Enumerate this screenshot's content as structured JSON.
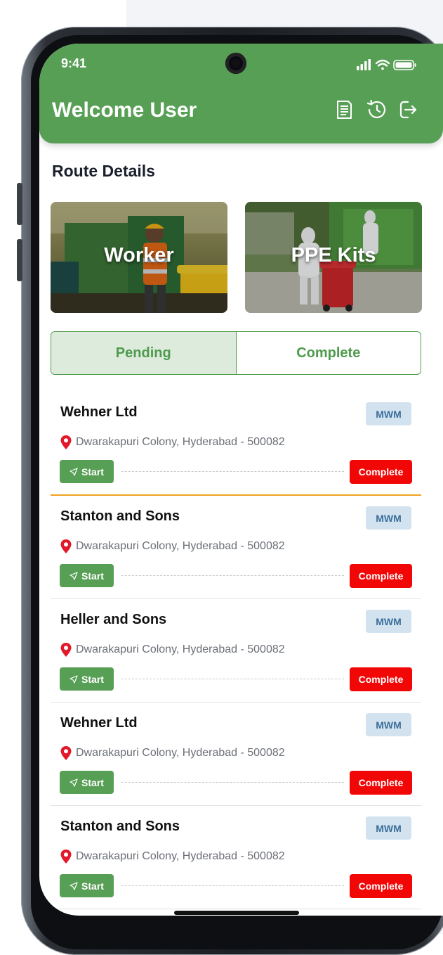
{
  "status_bar": {
    "time": "9:41"
  },
  "header": {
    "title": "Welcome User",
    "icons": [
      "notes-icon",
      "history-icon",
      "logout-icon"
    ]
  },
  "route": {
    "section_title": "Route Details",
    "cards": [
      {
        "label": "Worker",
        "image": "worker-photo"
      },
      {
        "label": "PPE Kits",
        "image": "ppe-kits-photo"
      }
    ]
  },
  "tabs": [
    {
      "label": "Pending",
      "active": true
    },
    {
      "label": "Complete",
      "active": false
    }
  ],
  "items": [
    {
      "name": "Wehner Ltd",
      "badge": "MWM",
      "address": "Dwarakapuri Colony, Hyderabad - 500082",
      "start_label": "Start",
      "complete_label": "Complete"
    },
    {
      "name": "Stanton and Sons",
      "badge": "MWM",
      "address": "Dwarakapuri Colony, Hyderabad - 500082",
      "start_label": "Start",
      "complete_label": "Complete"
    },
    {
      "name": "Heller and Sons",
      "badge": "MWM",
      "address": "Dwarakapuri Colony, Hyderabad - 500082",
      "start_label": "Start",
      "complete_label": "Complete"
    },
    {
      "name": "Wehner Ltd",
      "badge": "MWM",
      "address": "Dwarakapuri Colony, Hyderabad - 500082",
      "start_label": "Start",
      "complete_label": "Complete"
    },
    {
      "name": "Stanton and Sons",
      "badge": "MWM",
      "address": "Dwarakapuri Colony, Hyderabad - 500082",
      "start_label": "Start",
      "complete_label": "Complete"
    }
  ],
  "colors": {
    "header_green": "#589f56",
    "start_green": "#579f55",
    "complete_red": "#f20707",
    "badge_bg": "#d3e2ef",
    "badge_text": "#3b6f9c",
    "pin_red": "#e2182b",
    "active_divider": "#f0a11e"
  }
}
